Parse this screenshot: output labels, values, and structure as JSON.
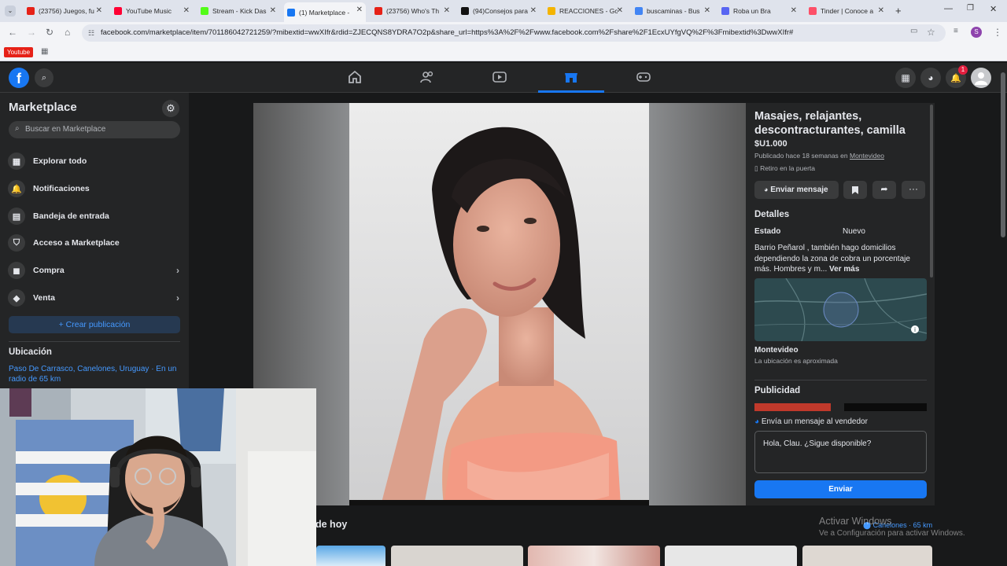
{
  "browser": {
    "tabs": [
      {
        "title": "(23756) Juegos, fu",
        "color": "#e62117"
      },
      {
        "title": "YouTube Music",
        "color": "#ff0033"
      },
      {
        "title": "Stream - Kick Das",
        "color": "#53fc18"
      },
      {
        "title": "(1) Marketplace -",
        "color": "#1877f2"
      },
      {
        "title": "(23756) Who's Th",
        "color": "#e62117"
      },
      {
        "title": "(94)Consejos para",
        "color": "#111111"
      },
      {
        "title": "REACCIONES - Go",
        "color": "#f4b400"
      },
      {
        "title": "buscaminas - Bus",
        "color": "#4285f4"
      },
      {
        "title": "Roba un Bra",
        "color": "#5865f2"
      },
      {
        "title": "Tinder | Conoce a",
        "color": "#fd5068"
      }
    ],
    "url": "facebook.com/marketplace/item/701186042721259/?mibextid=wwXIfr&rdid=ZJECQNS8YDRA7O2p&share_url=https%3A%2F%2Fwww.facebook.com%2Fshare%2F1EcxUYfgVQ%2F%3Fmibextid%3DwwXIfr#",
    "bookmark": "Youtube"
  },
  "header": {
    "notification_count": "1"
  },
  "sidebar": {
    "title": "Marketplace",
    "search_placeholder": "Buscar en Marketplace",
    "items": [
      {
        "label": "Explorar todo",
        "icon": "storefront-icon",
        "glyph": "▦"
      },
      {
        "label": "Notificaciones",
        "icon": "bell-icon",
        "glyph": "🔔"
      },
      {
        "label": "Bandeja de entrada",
        "icon": "inbox-icon",
        "glyph": "▤"
      },
      {
        "label": "Acceso a Marketplace",
        "icon": "shield-icon",
        "glyph": "⛉"
      },
      {
        "label": "Compra",
        "icon": "shopping-bag-icon",
        "glyph": "◼",
        "chevron": true
      },
      {
        "label": "Venta",
        "icon": "tag-icon",
        "glyph": "◆",
        "chevron": true
      }
    ],
    "create_button": "+ Crear publicación",
    "location_heading": "Ubicación",
    "location_text": "Paso De Carrasco, Canelones, Uruguay · En un radio de 65 km"
  },
  "listing": {
    "title": "Masajes, relajantes, descontracturantes, camilla",
    "price": "$U1.000",
    "published": "Publicado hace 18 semanas en",
    "published_place": "Montevideo",
    "pickup": "Retiro en la puerta",
    "message_button": "Enviar mensaje",
    "details_heading": "Detalles",
    "condition_label": "Estado",
    "condition_value": "Nuevo",
    "description": "Barrio Peñarol , también hago domicilios dependiendo la zona de cobra un porcentaje más. Hombres y m...",
    "see_more": "Ver más",
    "map_city": "Montevideo",
    "map_note": "La ubicación es aproximada",
    "ads_heading": "Publicidad",
    "seller_msg_heading": "Envía un mensaje al vendedor",
    "seller_msg_value": "Hola, Clau. ¿Sigue disponible?",
    "send_button": "Enviar"
  },
  "below": {
    "heading_partial": "de hoy",
    "location_pill": "Canelones · 65 km"
  },
  "watermark": {
    "line1": "Activar Windows",
    "line2": "Ve a Configuración para activar Windows."
  }
}
